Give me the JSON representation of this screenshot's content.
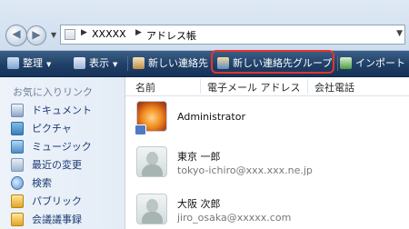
{
  "address_bar": {
    "crumbs": [
      "XXXXX",
      "アドレス帳"
    ]
  },
  "toolbar": {
    "organize": "整理",
    "view": "表示",
    "new_contact": "新しい連絡先",
    "new_group": "新しい連絡先グループ",
    "import": "インポート"
  },
  "sidebar": {
    "heading": "お気に入りリンク",
    "items": [
      "ドキュメント",
      "ピクチャ",
      "ミュージック",
      "最近の変更",
      "検索",
      "パブリック",
      "会議議事録"
    ]
  },
  "columns": {
    "name": "名前",
    "email": "電子メール アドレス",
    "phone": "会社電話"
  },
  "contacts": [
    {
      "name": "Administrator",
      "email": ""
    },
    {
      "name": "東京 一郎",
      "email": "tokyo-ichiro@xxx.xxx.ne.jp"
    },
    {
      "name": "大阪 次郎",
      "email": "jiro_osaka@xxxxx.com"
    }
  ]
}
